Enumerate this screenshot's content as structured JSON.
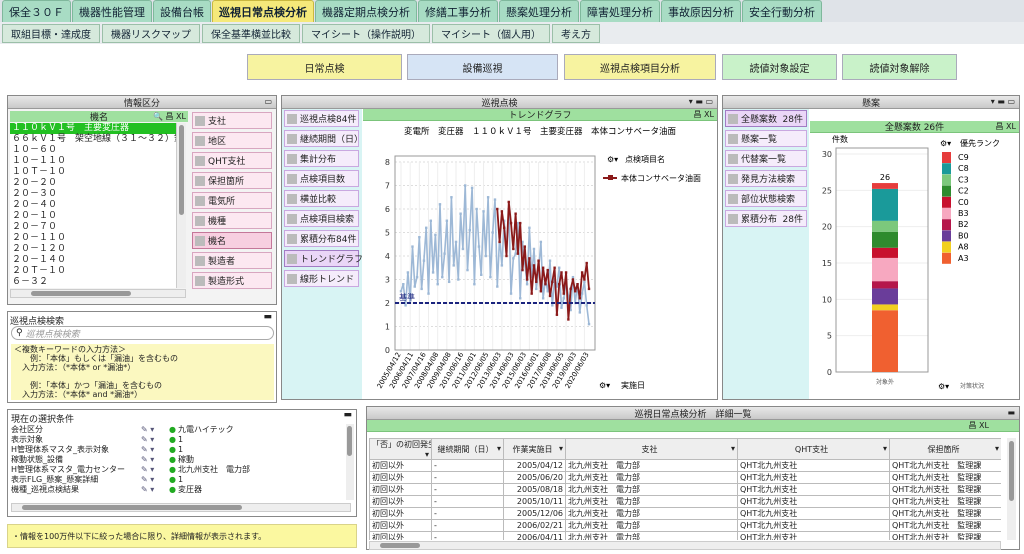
{
  "tabs1": [
    "保全３０Ｆ",
    "機器性能管理",
    "設備台帳",
    "巡視日常点検分析",
    "機器定期点検分析",
    "修繕工事分析",
    "懸案処理分析",
    "障害処理分析",
    "事故原因分析",
    "安全行動分析"
  ],
  "tabs1_active": 3,
  "tabs2": [
    "取組目標・達成度",
    "機器リスクマップ",
    "保全基準横並比較",
    "マイシート（操作説明）",
    "マイシート（個人用）",
    "考え方"
  ],
  "buttons": [
    {
      "label": "日常点検",
      "color": "#f7f3a0"
    },
    {
      "label": "設備巡視",
      "color": "#d6e4f5"
    },
    {
      "label": "巡視点検項目分析",
      "color": "#f7f3a0"
    },
    {
      "label": "読値対象設定",
      "color": "#c9f2c9"
    },
    {
      "label": "読値対象解除",
      "color": "#c9f2c9"
    }
  ],
  "info_panel": {
    "title": "情報区分",
    "header": "機名",
    "header_icons": "🔍 昌 XL",
    "items": [
      "１１０ｋＶ１号　主要変圧器",
      "６６ｋＶ１号　架空地線（３１～３２）鉄",
      "１０－６０",
      "１０－１１０",
      "１０Ｔ－１０",
      "２０－２０",
      "２０－３０",
      "２０－４０",
      "２０－１０",
      "２０－７０",
      "２０－１１０",
      "２０－１２０",
      "２０－１４０",
      "２０Ｔ－１０",
      "６－３２"
    ],
    "selected": 0,
    "side": [
      "支社",
      "地区",
      "QHT支社",
      "保担箇所",
      "電気所",
      "機種",
      "機名",
      "製造者",
      "製造形式"
    ],
    "side_selected": 6
  },
  "search_panel": {
    "title": "巡視点検検索",
    "placeholder": "巡視点検検索",
    "help": [
      "＜複数キーワードの入力方法＞",
      "　　例：「本体」もしくは「漏油」を含むもの",
      "　入力方法：（*本体* or *漏油*）",
      "",
      "　　例：「本体」かつ「漏油」を含むもの",
      "　入力方法：（*本体* and *漏油*）"
    ]
  },
  "cond_panel": {
    "title": "現在の選択条件",
    "rows": [
      {
        "k": "会社区分",
        "v": "九電ハイテック"
      },
      {
        "k": "表示対象",
        "v": "1"
      },
      {
        "k": "H管理体系マスタ_表示対象",
        "v": "1"
      },
      {
        "k": "稼動状態_設備",
        "v": "稼動"
      },
      {
        "k": "H管理体系マスタ_電力センター",
        "v": "北九州支社　電力部"
      },
      {
        "k": "表示FLG_懸案_懸案詳細",
        "v": "1"
      },
      {
        "k": "機種_巡視点検結果",
        "v": "変圧器"
      }
    ]
  },
  "notice": "・情報を100万件以下に絞った場合に限り、詳細情報が表示されます。",
  "trend_panel": {
    "title": "巡視点検",
    "gbar": "トレンドグラフ",
    "gbar_icons": "昌 XL",
    "side": [
      {
        "label": "巡視点検",
        "count": "84件"
      },
      {
        "label": "継続期間（日）",
        "count": ""
      },
      {
        "label": "集計分布",
        "count": ""
      },
      {
        "label": "点検項目数",
        "count": ""
      },
      {
        "label": "横並比較",
        "count": ""
      },
      {
        "label": "点検項目検索",
        "count": ""
      },
      {
        "label": "累積分布",
        "count": "84件"
      },
      {
        "label": "トレンドグラフ",
        "count": ""
      },
      {
        "label": "線形トレンド",
        "count": ""
      }
    ],
    "side_selected": 7
  },
  "chart_data": {
    "type": "line",
    "title": "変電所　変圧器　１１０ｋＶ１号　主要変圧器　本体コンサベータ油面",
    "legend_title": "点検項目名",
    "legend_entry": "本体コンサベータ油面",
    "xlabel": "実施日",
    "ylim": [
      0,
      8
    ],
    "yticks": [
      0,
      1,
      2,
      3,
      4,
      5,
      6,
      7,
      8
    ],
    "reference_label": "基準",
    "reference_value": 2,
    "xticks": [
      "2005/04/12",
      "2006/04/11",
      "2007/04/16",
      "2008/04/08",
      "2009/04/08",
      "2010/06/16",
      "2011/06/01",
      "2012/06/05",
      "2013/06/03",
      "2014/06/03",
      "2015/06/03",
      "2016/06/01",
      "2017/06/08",
      "2018/06/05",
      "2019/06/03",
      "2020/06/03"
    ],
    "series": [
      {
        "name": "",
        "color": "#9db8d6",
        "values": [
          2.5,
          2.8,
          1.9,
          3.3,
          2.1,
          4.4,
          2.7,
          3.1,
          4.8,
          2.6,
          3.8,
          5.2,
          2.4,
          5.5,
          3.3,
          4.9,
          2.8,
          6.2,
          3.1,
          4.1,
          5.5,
          2.9,
          6.5,
          3.6,
          4.6,
          3.0,
          5.8,
          4.3,
          7.0,
          3.4,
          5.1,
          6.9,
          2.8,
          6.0,
          4.4,
          3.2,
          5.9,
          4.0,
          6.5,
          3.1,
          5.0,
          6.4,
          2.7,
          4.8,
          3.6,
          5.5,
          4.2,
          6.0,
          2.4,
          3.9,
          4.1,
          5.4,
          2.2,
          4.6,
          3.7,
          2.8,
          5.2,
          3.1,
          4.3,
          2.6,
          3.4,
          4.6,
          2.2,
          3.0,
          2.5,
          3.8,
          1.9,
          3.0,
          2.7,
          3.5,
          1.8,
          2.2,
          2.9,
          2.3,
          1.7,
          3.1,
          2.0,
          2.8,
          1.6,
          2.4,
          2.9,
          1.9,
          1.1
        ]
      },
      {
        "name": "本体コンサベータ油面",
        "color": "#8b1a1a",
        "values": [
          null,
          null,
          null,
          null,
          null,
          null,
          null,
          null,
          null,
          null,
          null,
          null,
          null,
          null,
          null,
          null,
          null,
          null,
          null,
          null,
          null,
          null,
          null,
          null,
          null,
          null,
          null,
          null,
          null,
          null,
          null,
          null,
          null,
          null,
          null,
          null,
          null,
          null,
          null,
          null,
          null,
          null,
          6.0,
          4.6,
          5.9,
          5.2,
          4.0,
          6.3,
          5.4,
          4.3,
          5.8,
          4.1,
          5.4,
          3.4,
          4.4,
          3.0,
          3.9,
          2.4,
          3.6,
          2.9,
          3.8,
          2.5,
          3.5,
          2.8,
          3.4,
          2.3,
          2.9,
          3.5,
          1.5,
          2.8,
          3.3,
          2.4,
          3.3,
          1.3,
          2.6,
          3.0,
          2.5,
          2.8,
          2.2,
          3.3,
          3.0,
          3.7,
          2.6
        ]
      }
    ]
  },
  "pending_panel": {
    "title": "懸案",
    "gbar": "全懸案数 26件",
    "gbar_icons": "昌 XL",
    "side": [
      {
        "label": "全懸案数",
        "count": "28件"
      },
      {
        "label": "懸案一覧",
        "count": ""
      },
      {
        "label": "代替案一覧",
        "count": ""
      },
      {
        "label": "発見方法検索",
        "count": ""
      },
      {
        "label": "部位状態検索",
        "count": ""
      },
      {
        "label": "累積分布",
        "count": "28件"
      }
    ],
    "side_selected": 0
  },
  "bar_chart": {
    "ylabel": "件数",
    "ylim": [
      0,
      30
    ],
    "yticks": [
      0,
      5,
      10,
      15,
      20,
      25,
      30
    ],
    "total": 26,
    "category": "対象外",
    "xlabel": "対策状況",
    "legend_title": "優先ランク",
    "segments": [
      {
        "name": "A3",
        "value": 8.5,
        "color": "#f06030"
      },
      {
        "name": "A8",
        "value": 0.8,
        "color": "#f2d020"
      },
      {
        "name": "B0",
        "value": 2.2,
        "color": "#6a3d9a"
      },
      {
        "name": "B2",
        "value": 1.0,
        "color": "#b5174b"
      },
      {
        "name": "B3",
        "value": 3.2,
        "color": "#f7a8c0"
      },
      {
        "name": "C0",
        "value": 1.4,
        "color": "#c8102e"
      },
      {
        "name": "C2",
        "value": 2.2,
        "color": "#2e8b2e"
      },
      {
        "name": "C3",
        "value": 1.5,
        "color": "#7cc87c"
      },
      {
        "name": "C8",
        "value": 4.4,
        "color": "#1a9a9a"
      },
      {
        "name": "C9",
        "value": 0.8,
        "color": "#e63c3c"
      }
    ]
  },
  "detail_panel": {
    "title": "巡視日常点検分析　詳細一覧",
    "gbar_icons": "昌 XL",
    "headers": [
      "「否」の初回発生",
      "継続期間（日）",
      "作業実施日",
      "支社",
      "QHT支社",
      "保担箇所"
    ],
    "rows": [
      [
        "初回以外",
        "-",
        "2005/04/12",
        "北九州支社　電力部",
        "QHT北九州支社",
        "QHT北九州支社　監理課"
      ],
      [
        "初回以外",
        "-",
        "2005/06/20",
        "北九州支社　電力部",
        "QHT北九州支社",
        "QHT北九州支社　監理課"
      ],
      [
        "初回以外",
        "-",
        "2005/08/18",
        "北九州支社　電力部",
        "QHT北九州支社",
        "QHT北九州支社　監理課"
      ],
      [
        "初回以外",
        "-",
        "2005/10/11",
        "北九州支社　電力部",
        "QHT北九州支社",
        "QHT北九州支社　監理課"
      ],
      [
        "初回以外",
        "-",
        "2005/12/06",
        "北九州支社　電力部",
        "QHT北九州支社",
        "QHT北九州支社　監理課"
      ],
      [
        "初回以外",
        "-",
        "2006/02/21",
        "北九州支社　電力部",
        "QHT北九州支社",
        "QHT北九州支社　監理課"
      ],
      [
        "初回以外",
        "-",
        "2006/04/11",
        "北九州支社　電力部",
        "QHT北九州支社",
        "QHT北九州支社　監理課"
      ]
    ]
  }
}
